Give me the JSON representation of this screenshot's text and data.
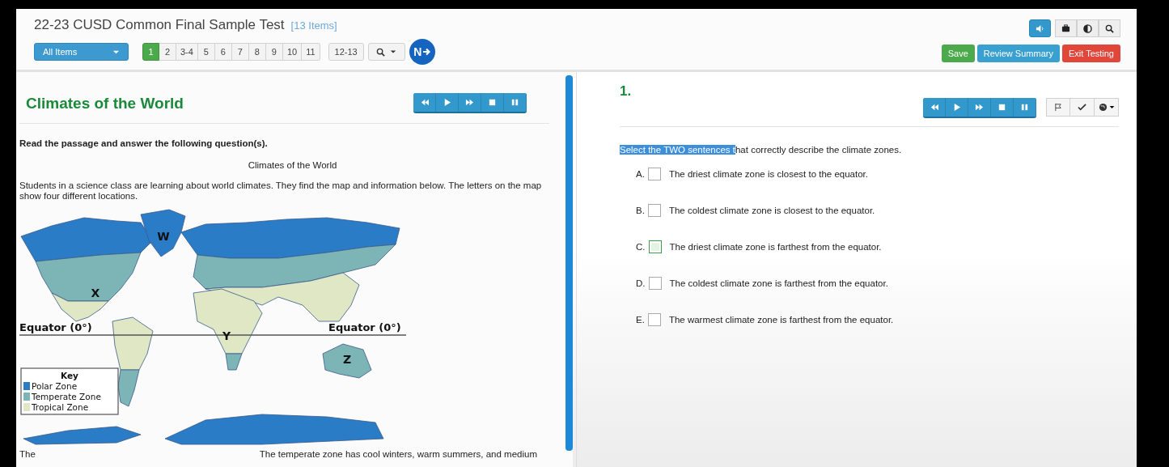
{
  "test": {
    "title": "22-23 CUSD Common Final Sample Test",
    "item_count": "[13 Items]"
  },
  "nav": {
    "filter": "All Items",
    "pages": [
      {
        "label": "1",
        "selected": true
      },
      {
        "label": "2",
        "selected": false
      },
      {
        "label": "3-4",
        "selected": false
      },
      {
        "label": "5",
        "selected": false
      },
      {
        "label": "6",
        "selected": false
      },
      {
        "label": "7",
        "selected": false
      },
      {
        "label": "8",
        "selected": false
      },
      {
        "label": "9",
        "selected": false
      },
      {
        "label": "10",
        "selected": false
      },
      {
        "label": "11",
        "selected": false
      }
    ],
    "more_pages": [
      {
        "label": "12-13",
        "selected": false
      }
    ],
    "next_label": "N"
  },
  "tools": [
    {
      "kind": "speaker",
      "selected": true
    },
    {
      "kind": "toolbox",
      "selected": false
    },
    {
      "kind": "contrast",
      "selected": false
    },
    {
      "kind": "zoom",
      "selected": false
    }
  ],
  "actions": [
    {
      "label": "Save",
      "kind": "save"
    },
    {
      "label": "Review Summary",
      "kind": "review"
    },
    {
      "label": "Exit Testing",
      "kind": "exit"
    }
  ],
  "passage": {
    "title": "Climates of the World",
    "audio_controls": [
      {
        "kind": "rewind"
      },
      {
        "kind": "play"
      },
      {
        "kind": "forward"
      },
      {
        "kind": "stop"
      },
      {
        "kind": "pause"
      }
    ],
    "instruction": "Read the passage and answer the following question(s).",
    "heading": "Climates of the World",
    "body": "Students in a science class are learning about world climates. They find the map and information below.  The letters on the map show four different locations.",
    "map": {
      "location_labels": [
        "W",
        "X",
        "Y",
        "Z"
      ],
      "equator_labels": [
        "Equator (0°)",
        "Equator (0°)"
      ],
      "key": {
        "title": "Key",
        "items": [
          {
            "label": "Polar Zone",
            "color": "#2a7cc6"
          },
          {
            "label": "Temperate Zone",
            "color": "#7db4b6"
          },
          {
            "label": "Tropical Zone",
            "color": "#dfe7c4"
          }
        ]
      }
    },
    "continuation": [
      "The",
      "The temperate zone has cool winters, warm summers, and medium"
    ]
  },
  "question": {
    "number": "1.",
    "audio_controls": [
      {
        "kind": "rewind"
      },
      {
        "kind": "play"
      },
      {
        "kind": "forward"
      },
      {
        "kind": "stop"
      },
      {
        "kind": "pause"
      }
    ],
    "item_tools": [
      {
        "kind": "flag"
      },
      {
        "kind": "check"
      },
      {
        "kind": "globe"
      }
    ],
    "prompt_highlighted": "Select the TWO sentences t",
    "prompt_rest": "hat correctly describe the climate zones.",
    "options": [
      {
        "letter": "A.",
        "text": "The driest climate zone is closest to the equator.",
        "checked": false,
        "highlighted": false
      },
      {
        "letter": "B.",
        "text": "The coldest climate zone is closest to the equator.",
        "checked": false,
        "highlighted": false
      },
      {
        "letter": "C.",
        "text": "The driest climate zone is farthest from the equator.",
        "checked": false,
        "highlighted": true
      },
      {
        "letter": "D.",
        "text": "The coldest climate zone is farthest from the equator.",
        "checked": false,
        "highlighted": false
      },
      {
        "letter": "E.",
        "text": "The warmest climate zone is farthest from the equator.",
        "checked": false,
        "highlighted": false
      }
    ]
  }
}
